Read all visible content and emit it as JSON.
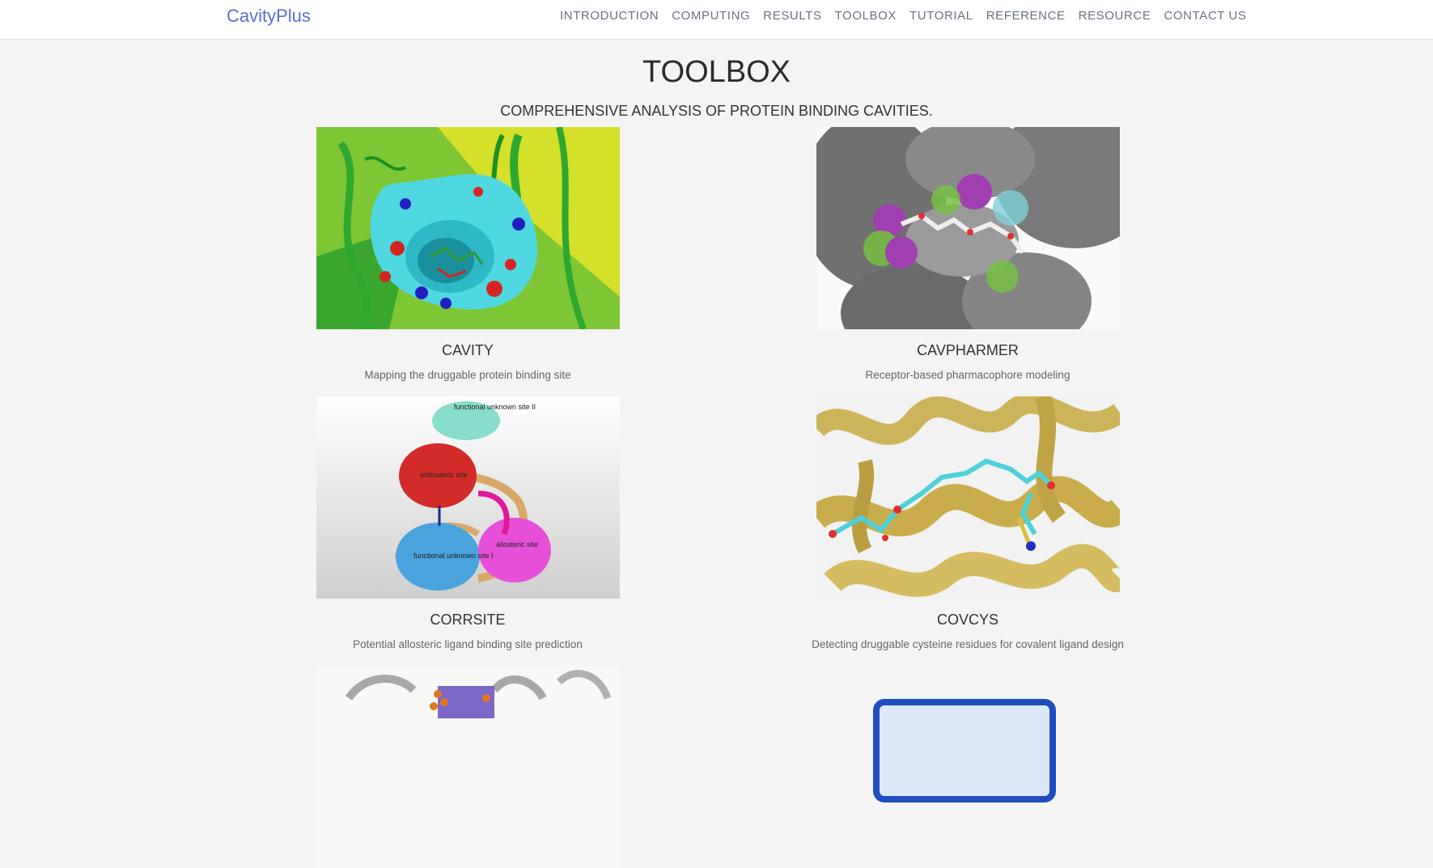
{
  "nav": {
    "brand": "CavityPlus",
    "items": [
      "INTRODUCTION",
      "COMPUTING",
      "RESULTS",
      "TOOLBOX",
      "TUTORIAL",
      "REFERENCE",
      "RESOURCE",
      "CONTACT US"
    ]
  },
  "header": {
    "title": "TOOLBOX",
    "subtitle": "COMPREHENSIVE ANALYSIS OF PROTEIN BINDING CAVITIES."
  },
  "tools": [
    {
      "name": "CAVITY",
      "description": "Mapping the druggable protein binding site"
    },
    {
      "name": "CAVPHARMER",
      "description": "Receptor-based pharmacophore modeling"
    },
    {
      "name": "CORRSITE",
      "description": "Potential allosteric ligand binding site prediction"
    },
    {
      "name": "COVCYS",
      "description": "Detecting druggable cysteine residues for covalent ligand design"
    }
  ],
  "figure_labels": {
    "site2": "functional unknown site II",
    "orthosteric": "orthosteric site",
    "allosteric": "allosteric site",
    "site1": "functional unknown site I"
  },
  "colors": {
    "brand": "#5a6fd8",
    "nav_text": "#6b7280",
    "background": "#f4f4f4"
  }
}
